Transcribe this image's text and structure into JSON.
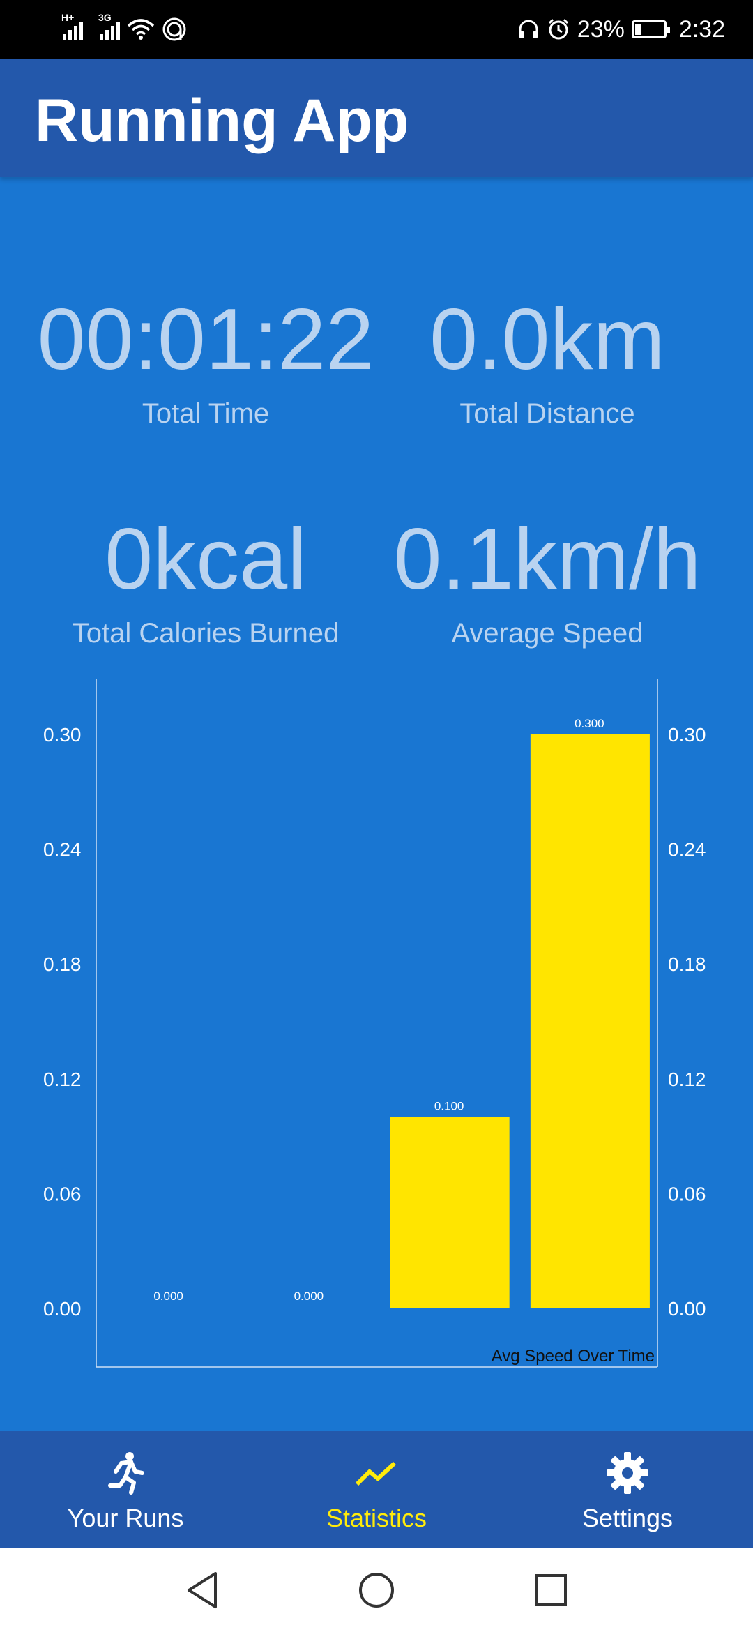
{
  "status_bar": {
    "network_1": "H+",
    "network_2": "3G",
    "battery": "23%",
    "battery_level": 0.23,
    "time": "2:32"
  },
  "app": {
    "title": "Running App"
  },
  "stats": {
    "total_time": {
      "value": "00:01:22",
      "label": "Total Time"
    },
    "total_distance": {
      "value": "0.0km",
      "label": "Total Distance"
    },
    "total_calories": {
      "value": "0kcal",
      "label": "Total Calories Burned"
    },
    "average_speed": {
      "value": "0.1km/h",
      "label": "Average Speed"
    }
  },
  "chart_data": {
    "type": "bar",
    "description_label": "Avg Speed Over Time",
    "values": [
      0.0,
      0.0,
      0.1,
      0.3
    ],
    "value_labels": [
      "0.000",
      "0.000",
      "0.100",
      "0.300"
    ],
    "ylim": [
      0,
      0.3
    ],
    "y_ticks": [
      "0.00",
      "0.06",
      "0.12",
      "0.18",
      "0.24",
      "0.30"
    ],
    "bar_color": "#ffe500",
    "both_axes_labeled": true
  },
  "bottom_nav": {
    "items": [
      {
        "label": "Your Runs",
        "icon": "runner-icon",
        "active": false
      },
      {
        "label": "Statistics",
        "icon": "trend-icon",
        "active": true
      },
      {
        "label": "Settings",
        "icon": "gear-icon",
        "active": false
      }
    ]
  },
  "colors": {
    "background": "#1976d2",
    "app_bar": "#2358ab",
    "accent": "#ffeb0a",
    "stat_text": "#b9d3f0"
  }
}
